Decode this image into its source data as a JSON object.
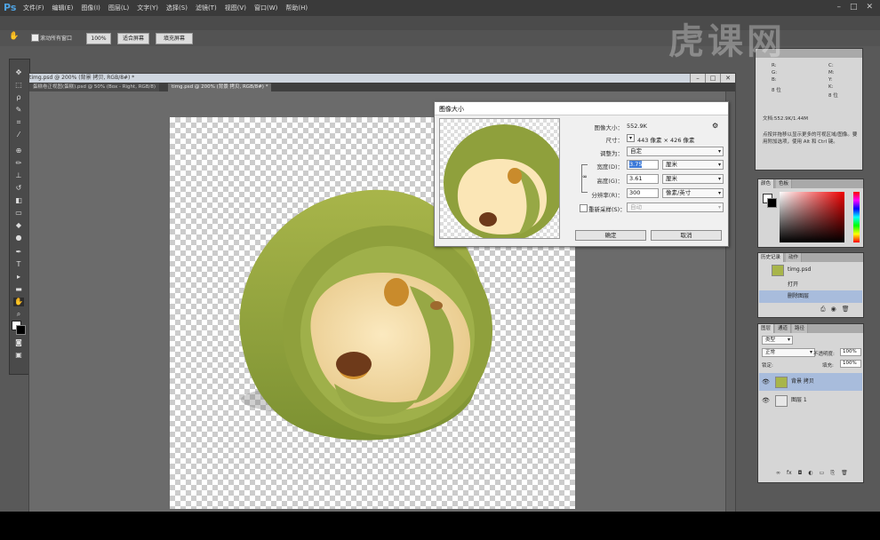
{
  "app": {
    "logo": "Ps"
  },
  "menu": [
    "文件(F)",
    "编辑(E)",
    "图像(I)",
    "图层(L)",
    "文字(Y)",
    "选择(S)",
    "滤镜(T)",
    "视图(V)",
    "窗口(W)",
    "帮助(H)"
  ],
  "options_bar": {
    "scroll_all_label": "滚动所有窗口",
    "btn_100": "100%",
    "btn_fit": "适合屏幕",
    "btn_fill": "填充屏幕"
  },
  "document": {
    "title": "timg.psd @ 200% (背景 拷贝, RGB/8#) *",
    "tabs": [
      "蛋糕卷正视图(蛋糕).psd @ 50% (Box - Right, RGB/8)",
      "timg.psd @ 200% (背景 拷贝, RGB/8#) *"
    ]
  },
  "dialog": {
    "title": "图像大小",
    "image_size_label": "图像大小：",
    "image_size_value": "552.9K",
    "dimensions_label": "尺寸：",
    "dimensions_value": "443 像素 × 426 像素",
    "fit_label": "调整为：",
    "fit_value": "自定",
    "width_label": "宽度(D)：",
    "width_value": "3.75",
    "width_unit": "厘米",
    "height_label": "高度(G)：",
    "height_value": "3.61",
    "height_unit": "厘米",
    "res_label": "分辨率(R)：",
    "res_value": "300",
    "res_unit": "像素/英寸",
    "resample_label": "重新采样(S)：",
    "resample_value": "自动",
    "ok": "确定",
    "cancel": "取消"
  },
  "info_panel": {
    "lines": [
      "R:",
      "G:",
      "B:",
      "8 位"
    ],
    "lines_right": [
      "C:",
      "M:",
      "Y:",
      "K:",
      "8 位"
    ],
    "doc": "文档:552.9K/1.44M",
    "hint1": "点按并拖移以显示更多的可视区域/图像。要",
    "hint2": "用附加选项，使用 Alt 和 Ctrl 键。"
  },
  "color_panel": {
    "tabs": [
      "颜色",
      "色板"
    ]
  },
  "history_panel": {
    "tabs": [
      "历史记录",
      "动作"
    ],
    "snapshot": "timg.psd",
    "items": [
      "打开",
      "删除图层"
    ]
  },
  "layers_panel": {
    "tabs": [
      "图层",
      "通道",
      "路径"
    ],
    "kind": "类型",
    "blend": "正常",
    "opacity_label": "不透明度:",
    "opacity": "100%",
    "lock_label": "锁定:",
    "fill_label": "填充:",
    "fill": "100%",
    "layers": [
      "背景 拷贝",
      "图层 1"
    ]
  },
  "watermark": "虎课网",
  "colors": {
    "selection": "#a8bcdc",
    "accent": "#3a78d8"
  }
}
